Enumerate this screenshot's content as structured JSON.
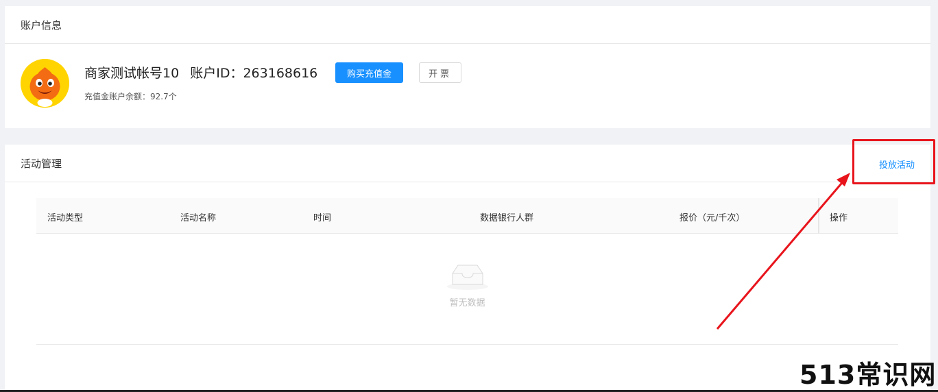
{
  "account": {
    "section_title": "账户信息",
    "name": "商家测试帐号10",
    "id_text": "账户ID：263168616",
    "buy_button": "购买充值金",
    "invoice_button": "开票",
    "balance_text": "充值金账户余额：92.7个"
  },
  "activity": {
    "section_title": "活动管理",
    "launch_link": "投放活动",
    "columns": [
      "活动类型",
      "活动名称",
      "时间",
      "数据银行人群",
      "报价（元/千次）",
      "操作"
    ],
    "empty_text": "暂无数据"
  },
  "watermark": "513常识网",
  "colors": {
    "primary": "#1890ff",
    "annotation_red": "#e8141c",
    "background": "#f0f2f5"
  },
  "icons": [
    "avatar-mascot",
    "empty-inbox-icon",
    "annotation-arrow"
  ]
}
